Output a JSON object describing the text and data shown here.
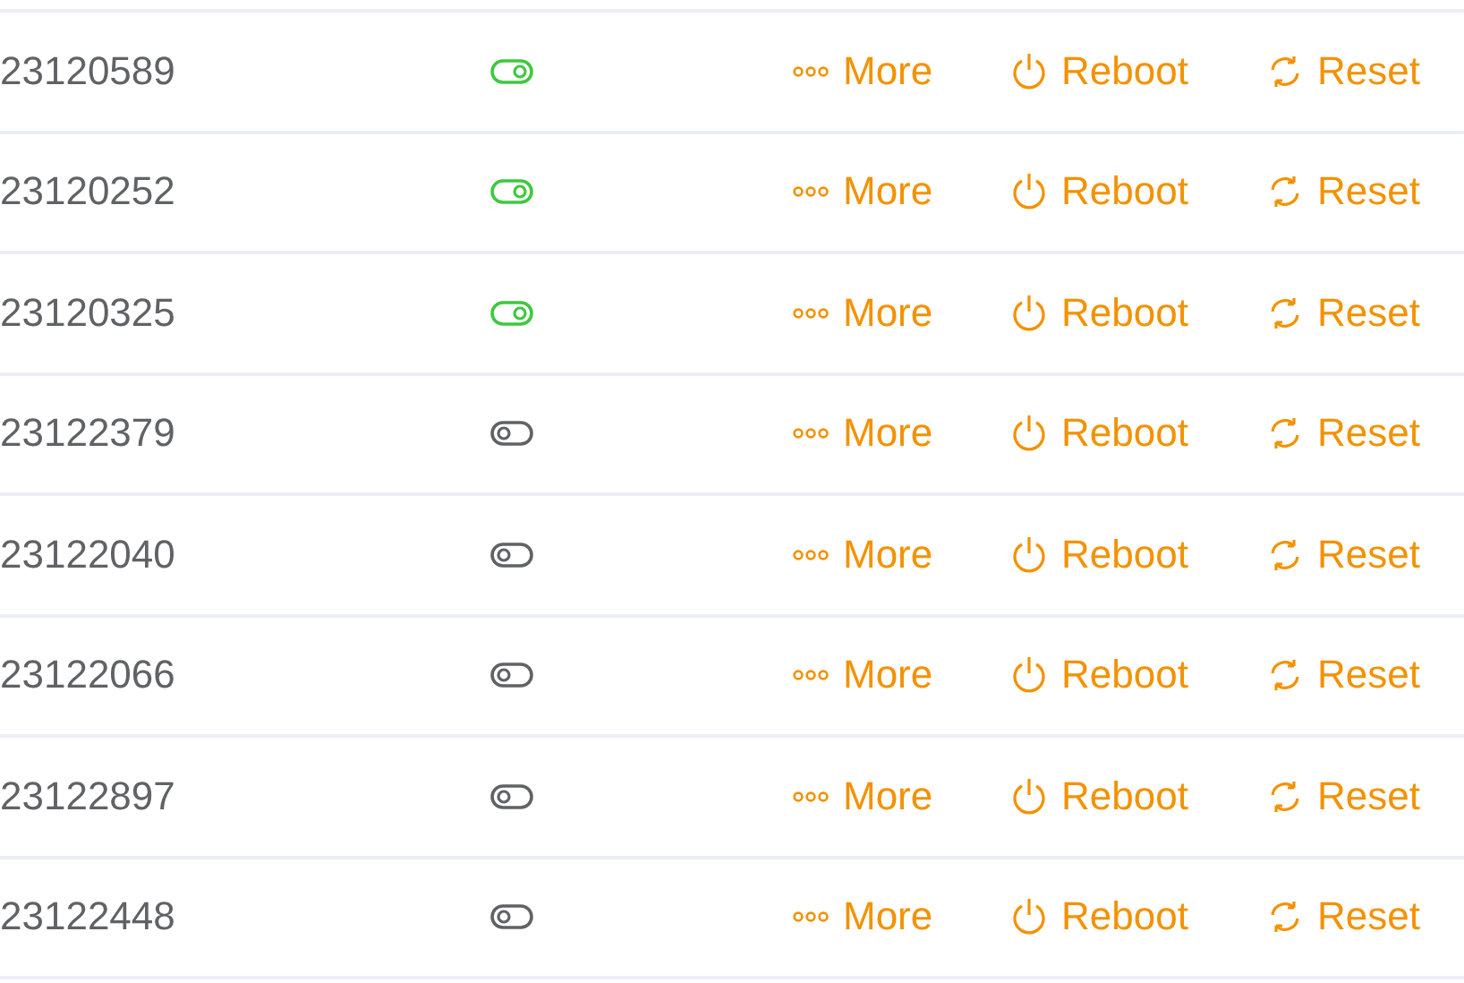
{
  "rows": [
    {
      "serial": "23120589",
      "enabled": true,
      "actions": [
        "More",
        "Reboot",
        "Reset"
      ]
    },
    {
      "serial": "23120252",
      "enabled": true,
      "actions": [
        "More",
        "Reboot",
        "Reset"
      ]
    },
    {
      "serial": "23120325",
      "enabled": true,
      "actions": [
        "More",
        "Reboot",
        "Reset"
      ]
    },
    {
      "serial": "23122379",
      "enabled": false,
      "actions": [
        "More",
        "Reboot",
        "Reset"
      ]
    },
    {
      "serial": "23122040",
      "enabled": false,
      "actions": [
        "More",
        "Reboot",
        "Reset"
      ]
    },
    {
      "serial": "23122066",
      "enabled": false,
      "actions": [
        "More",
        "Reboot",
        "Reset"
      ]
    },
    {
      "serial": "23122897",
      "enabled": false,
      "actions": [
        "More",
        "Reboot",
        "Reset"
      ]
    },
    {
      "serial": "23122448",
      "enabled": false,
      "actions": [
        "More",
        "Reboot",
        "Reset"
      ]
    }
  ]
}
